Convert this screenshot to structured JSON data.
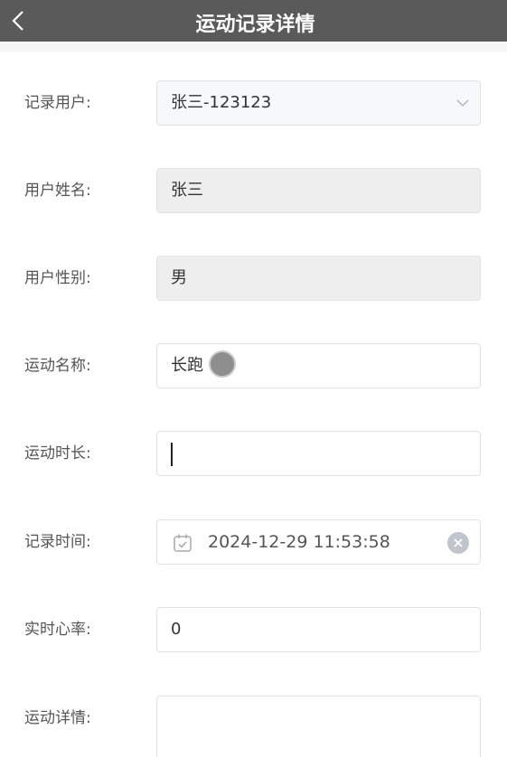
{
  "header": {
    "title": "运动记录详情",
    "back_icon": "chevron-left-icon"
  },
  "form": {
    "record_user": {
      "label": "记录用户:",
      "value": "张三-123123"
    },
    "user_name": {
      "label": "用户姓名:",
      "value": "张三"
    },
    "user_gender": {
      "label": "用户性别:",
      "value": "男"
    },
    "sport_name": {
      "label": "运动名称:",
      "value": "长跑"
    },
    "sport_duration": {
      "label": "运动时长:",
      "value": ""
    },
    "record_time": {
      "label": "记录时间:",
      "value": "2024-12-29 11:53:58"
    },
    "heart_rate": {
      "label": "实时心率:",
      "value": "0"
    },
    "sport_detail": {
      "label": "运动详情:",
      "value": ""
    }
  },
  "colors": {
    "header_bg": "#5a5a5a",
    "disabled_bg": "#eeeeee",
    "border": "#e2e2e2"
  }
}
